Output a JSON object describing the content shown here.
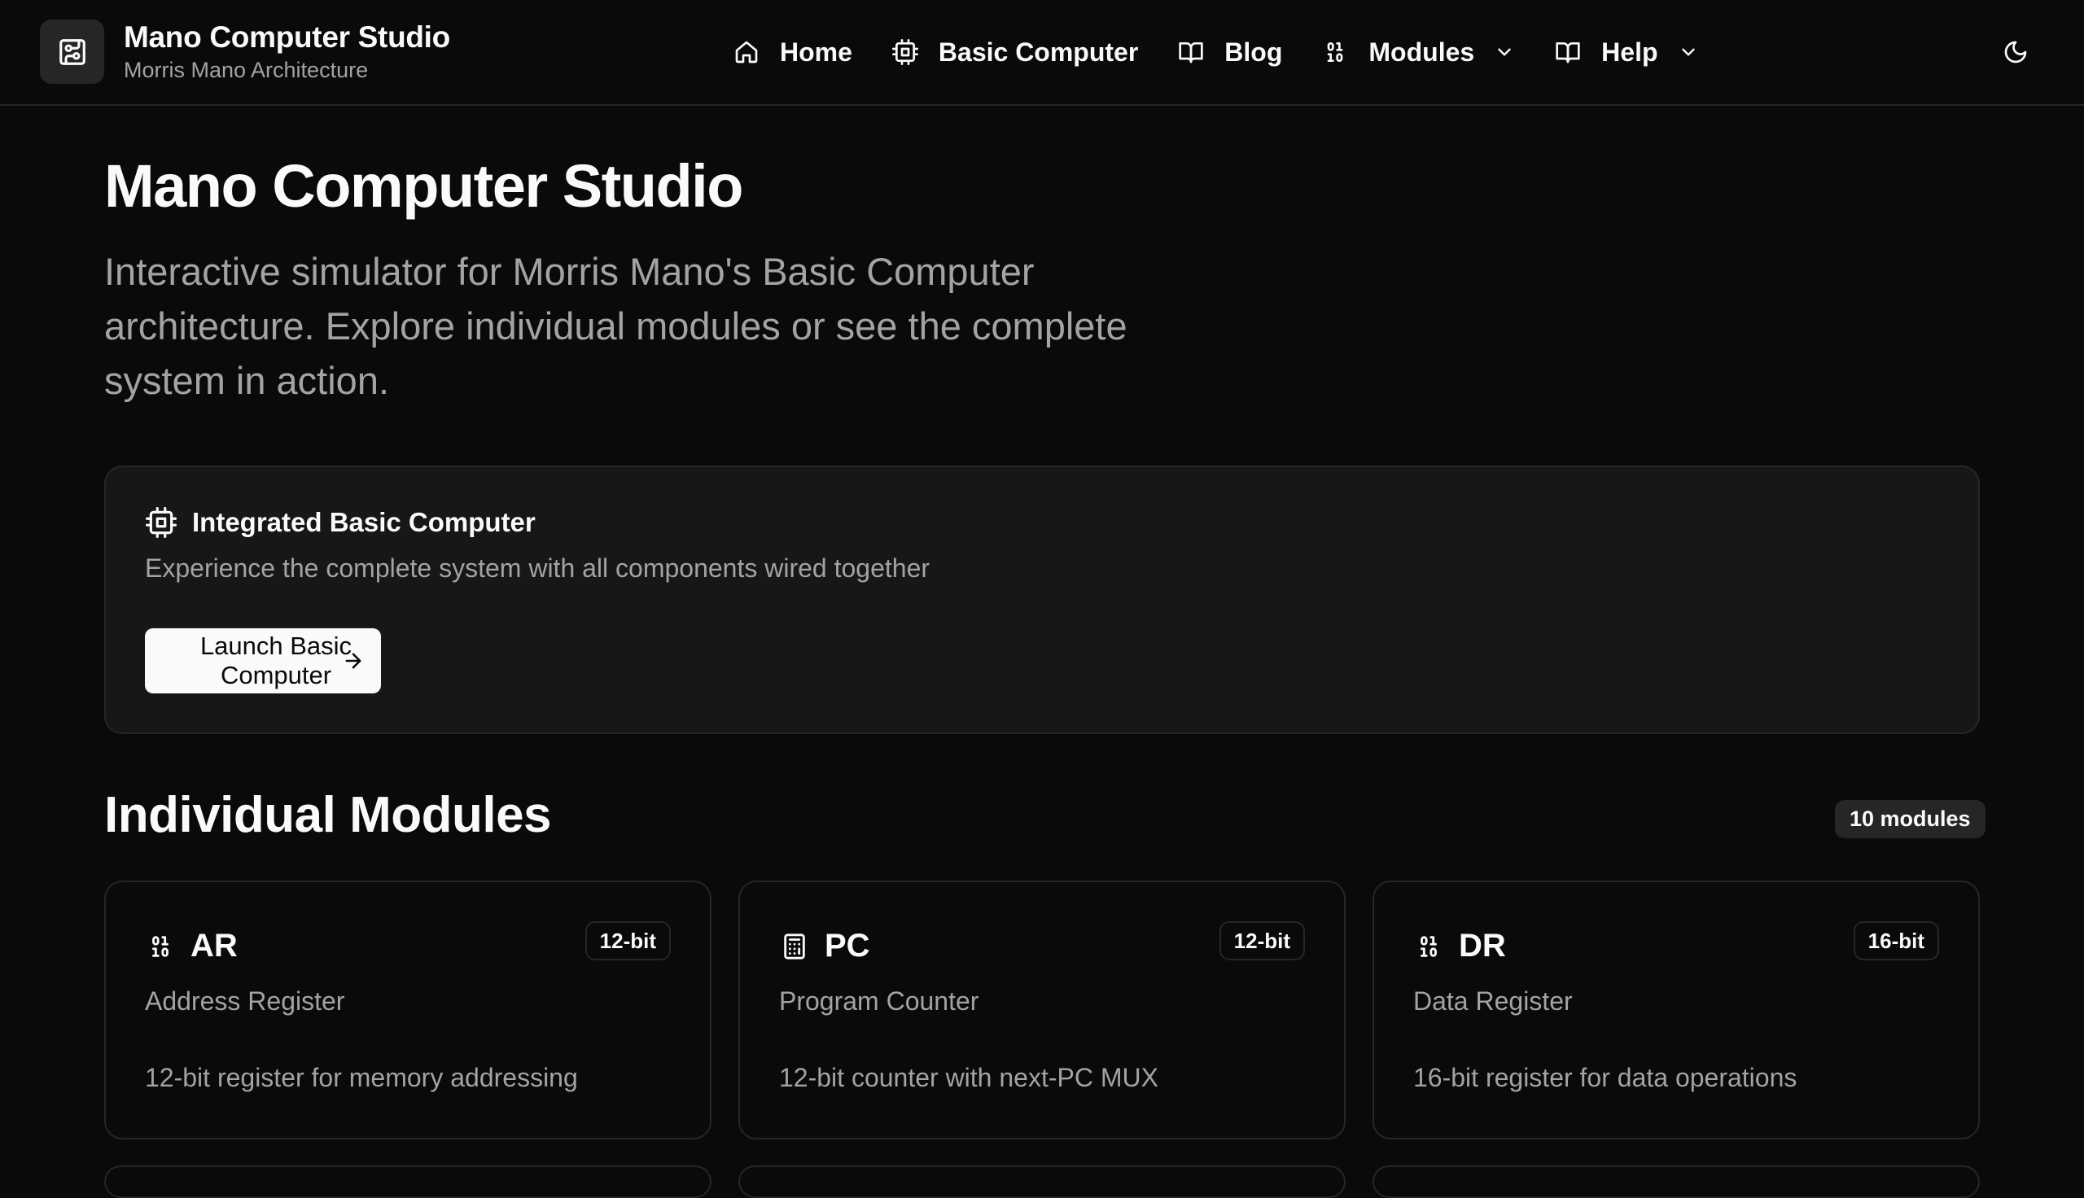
{
  "header": {
    "brand_title": "Mano Computer Studio",
    "brand_subtitle": "Morris Mano Architecture",
    "logo_icon": "circuit-board-icon",
    "nav": [
      {
        "label": "Home",
        "icon": "home-icon",
        "dropdown": false
      },
      {
        "label": "Basic Computer",
        "icon": "cpu-icon",
        "dropdown": false
      },
      {
        "label": "Blog",
        "icon": "book-open-icon",
        "dropdown": false
      },
      {
        "label": "Modules",
        "icon": "binary-icon",
        "dropdown": true
      },
      {
        "label": "Help",
        "icon": "book-open-icon",
        "dropdown": true
      }
    ],
    "theme_icon": "moon-icon"
  },
  "hero": {
    "title": "Mano Computer Studio",
    "description": "Interactive simulator for Morris Mano's Basic Computer architecture. Explore individual modules or see the complete system in action."
  },
  "featured": {
    "icon": "cpu-icon",
    "title": "Integrated Basic Computer",
    "description": "Experience the complete system with all components wired together",
    "button_label": "Launch Basic Computer",
    "button_icon": "arrow-right-icon"
  },
  "modules": {
    "title": "Individual Modules",
    "count_label": "10 modules",
    "items": [
      {
        "name": "AR",
        "bits": "12-bit",
        "full_name": "Address Register",
        "description": "12-bit register for memory addressing",
        "icon": "binary-icon"
      },
      {
        "name": "PC",
        "bits": "12-bit",
        "full_name": "Program Counter",
        "description": "12-bit counter with next-PC MUX",
        "icon": "calculator-icon"
      },
      {
        "name": "DR",
        "bits": "16-bit",
        "full_name": "Data Register",
        "description": "16-bit register for data operations",
        "icon": "binary-icon"
      }
    ]
  },
  "colors": {
    "background": "#0a0a0a",
    "card": "#171717",
    "border": "#262626",
    "text": "#fafafa",
    "muted_text": "#a3a3a3"
  }
}
